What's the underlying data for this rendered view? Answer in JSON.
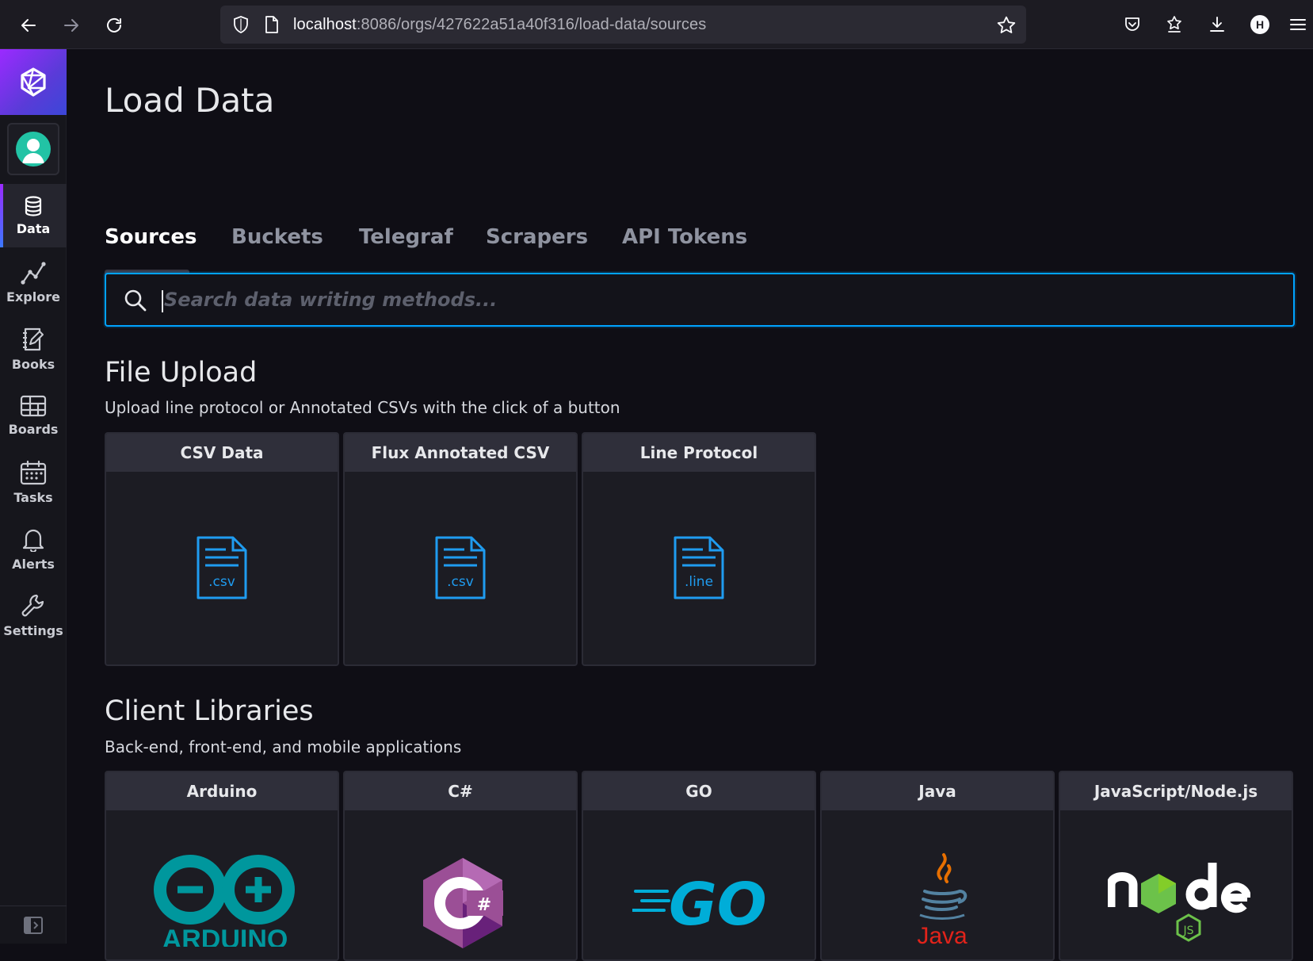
{
  "browser": {
    "url_host": "localhost",
    "url_rest": ":8086/orgs/427622a51a40f316/load-data/sources",
    "account_initial": "H"
  },
  "sidebar": {
    "items": [
      {
        "label": "Data",
        "icon": "database-icon",
        "active": true
      },
      {
        "label": "Explore",
        "icon": "graph-icon"
      },
      {
        "label": "Books",
        "icon": "notebook-icon"
      },
      {
        "label": "Boards",
        "icon": "dashboard-icon"
      },
      {
        "label": "Tasks",
        "icon": "calendar-icon"
      },
      {
        "label": "Alerts",
        "icon": "bell-icon"
      },
      {
        "label": "Settings",
        "icon": "wrench-icon"
      }
    ]
  },
  "page": {
    "title": "Load Data",
    "tabs": [
      "Sources",
      "Buckets",
      "Telegraf",
      "Scrapers",
      "API Tokens"
    ],
    "active_tab": "Sources",
    "search_placeholder": "Search data writing methods..."
  },
  "file_upload": {
    "title": "File Upload",
    "subtitle": "Upload line protocol or Annotated CSVs with the click of a button",
    "cards": [
      {
        "label": "CSV Data",
        "ext": ".csv"
      },
      {
        "label": "Flux Annotated CSV",
        "ext": ".csv"
      },
      {
        "label": "Line Protocol",
        "ext": ".line"
      }
    ]
  },
  "client_libraries": {
    "title": "Client Libraries",
    "subtitle": "Back-end, front-end, and mobile applications",
    "cards": [
      {
        "label": "Arduino",
        "logo": "arduino-logo",
        "logo_text": "ARDUINO"
      },
      {
        "label": "C#",
        "logo": "csharp-logo"
      },
      {
        "label": "GO",
        "logo": "go-logo",
        "logo_text": "GO"
      },
      {
        "label": "Java",
        "logo": "java-logo",
        "logo_text": "Java"
      },
      {
        "label": "JavaScript/Node.js",
        "logo": "nodejs-logo",
        "logo_text": "node"
      }
    ]
  },
  "colors": {
    "accent": "#00a3ff",
    "brand_gradient_start": "#9b2aff",
    "brand_gradient_end": "#3b47d8",
    "file_icon": "#1f9cf0"
  }
}
